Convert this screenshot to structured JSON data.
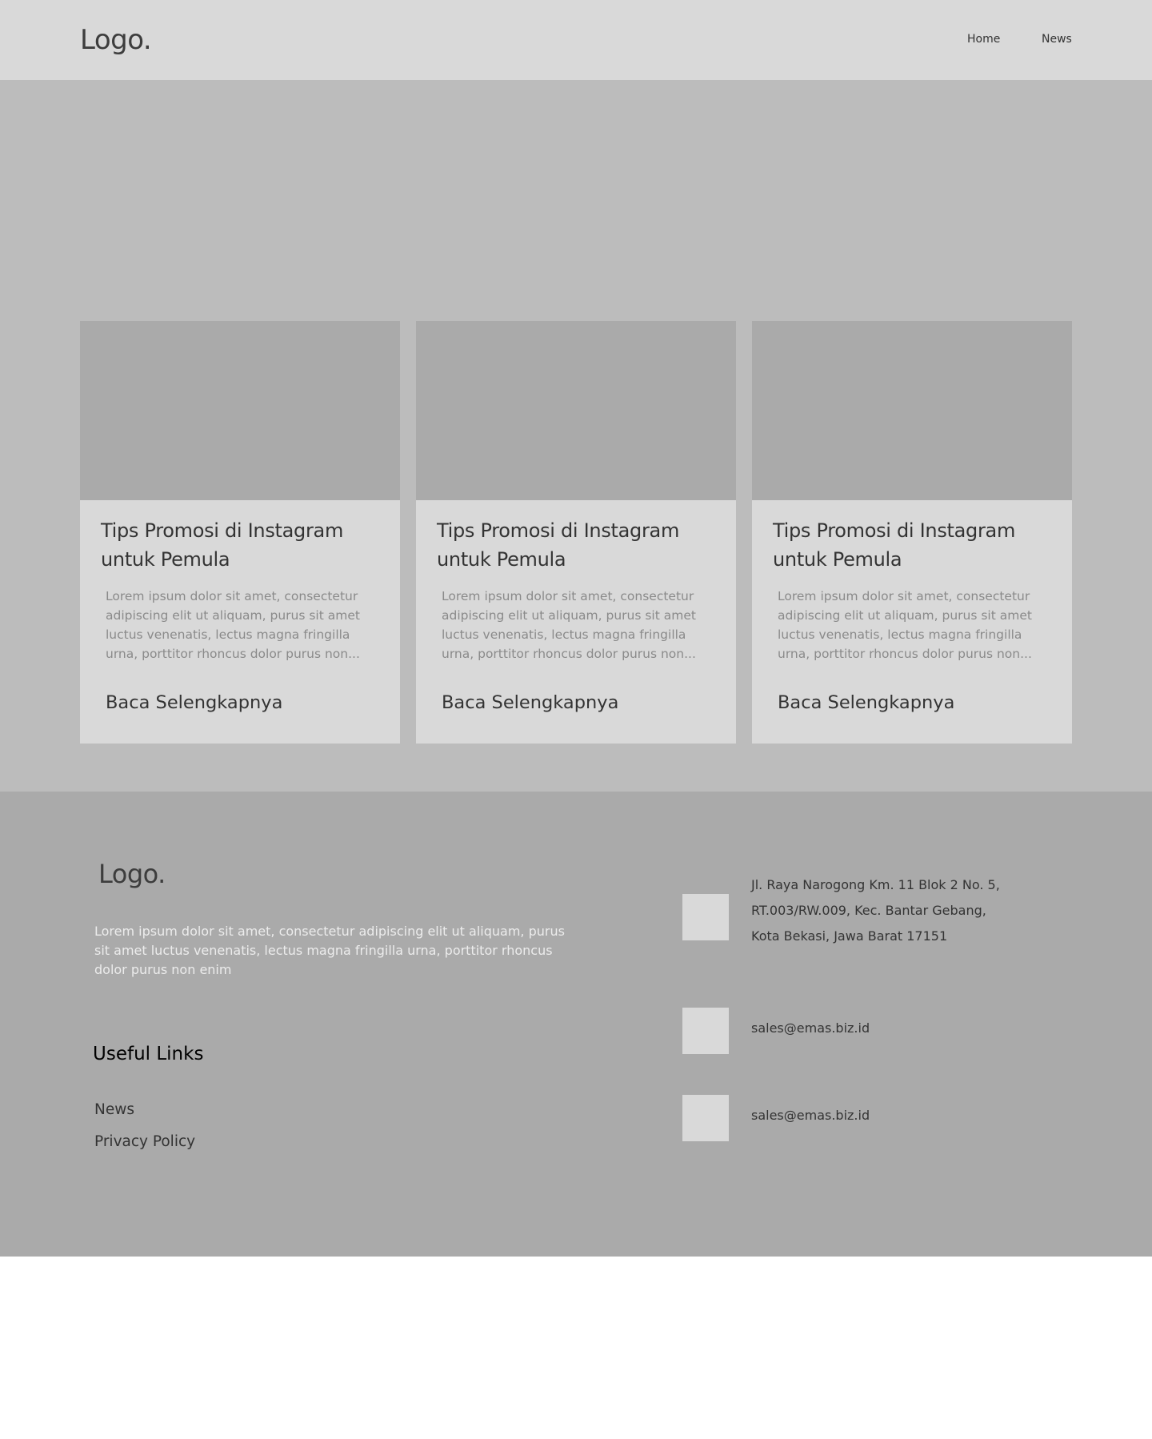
{
  "header": {
    "logo": "Logo.",
    "nav": [
      {
        "label": "Home"
      },
      {
        "label": "News"
      }
    ]
  },
  "news": {
    "cards": [
      {
        "title": "Tips Promosi di Instagram untuk Pemula",
        "excerpt": "Lorem ipsum dolor sit amet, consectetur adipiscing elit ut aliquam, purus sit amet luctus venenatis, lectus magna fringilla urna, porttitor rhoncus dolor purus non...",
        "link_label": "Baca Selengkapnya"
      },
      {
        "title": "Tips Promosi di Instagram untuk Pemula",
        "excerpt": "Lorem ipsum dolor sit amet, consectetur adipiscing elit ut aliquam, purus sit amet luctus venenatis, lectus magna fringilla urna, porttitor rhoncus dolor purus non...",
        "link_label": "Baca Selengkapnya"
      },
      {
        "title": "Tips Promosi di Instagram untuk Pemula",
        "excerpt": "Lorem ipsum dolor sit amet, consectetur adipiscing elit ut aliquam, purus sit amet luctus venenatis, lectus magna fringilla urna, porttitor rhoncus dolor purus non...",
        "link_label": "Baca Selengkapnya"
      }
    ]
  },
  "footer": {
    "logo": "Logo.",
    "description": "Lorem ipsum dolor sit amet, consectetur adipiscing elit ut aliquam, purus sit amet luctus venenatis, lectus magna fringilla urna, porttitor rhoncus dolor purus non enim",
    "useful_links_heading": "Useful Links",
    "links": [
      {
        "label": "News"
      },
      {
        "label": "Privacy Policy"
      }
    ],
    "contact": {
      "address_lines": [
        "Jl. Raya Narogong Km. 11 Blok 2 No. 5,",
        "RT.003/RW.009, Kec. Bantar Gebang,",
        "Kota Bekasi, Jawa Barat 17151"
      ],
      "emails": [
        "sales@emas.biz.id",
        "sales@emas.biz.id"
      ]
    }
  },
  "colors": {
    "header_bg": "#d9d9d9",
    "section_bg": "#bcbcbc",
    "footer_bg": "#aaaaaa",
    "card_bg": "#d9d9d9",
    "image_placeholder": "#aaaaaa",
    "text_dark": "#333333"
  }
}
